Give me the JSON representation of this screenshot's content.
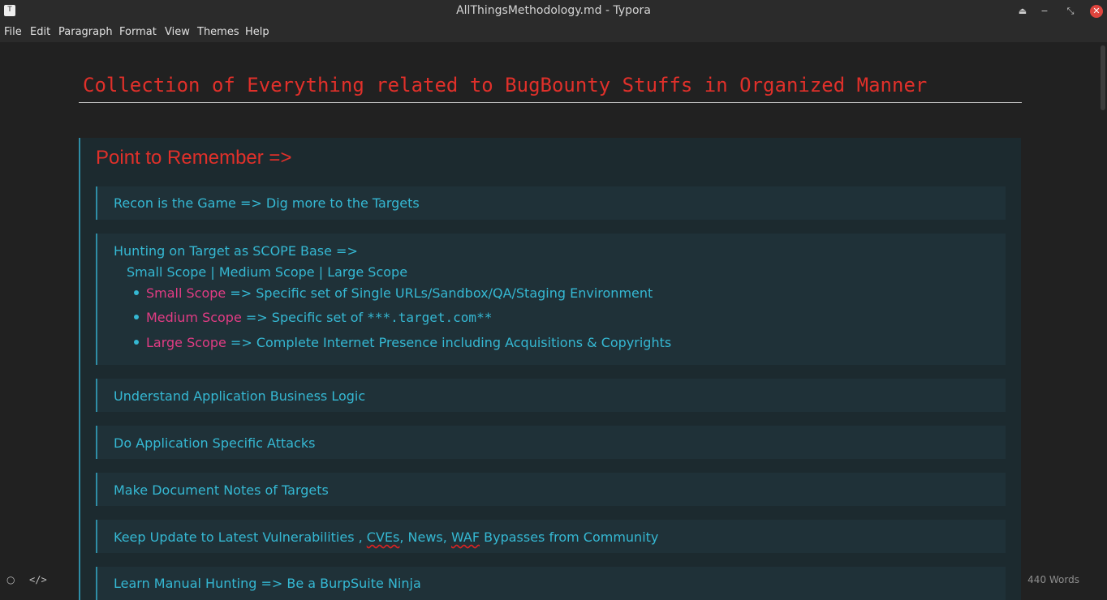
{
  "window": {
    "title": "AllThingsMethodology.md - Typora",
    "app_icon_glyph": "T"
  },
  "menu": [
    "File",
    "Edit",
    "Paragraph",
    "Format",
    "View",
    "Themes",
    "Help"
  ],
  "document": {
    "title": "Collection of Everything related to BugBounty Stuffs in Organized Manner",
    "section_heading": "Point to Remember =>",
    "items": {
      "recon": "Recon is the Game => Dig more to the Targets",
      "scope_intro": "Hunting on Target as SCOPE Base =>",
      "scope_line": "Small Scope | Medium Scope | Large Scope",
      "small_label": "Small Scope",
      "small_desc": " => Specific set of Single URLs/Sandbox/QA/Staging Environment",
      "medium_label": "Medium Scope",
      "medium_desc": " => Specific set of ",
      "medium_code": "***.target.com**",
      "large_label": "Large Scope",
      "large_desc": " => Complete Internet Presence including Acquisitions & Copyrights",
      "business_logic": "Understand Application Business Logic",
      "attacks": "Do Application Specific Attacks",
      "notes": "Make Document Notes of Targets",
      "update_a": "Keep Update to Latest Vulnerabilities , ",
      "update_cves": "CVEs",
      "update_b": ", News, ",
      "update_waf": "WAF",
      "update_c": " Bypasses from Community",
      "manual": "Learn Manual Hunting => Be a BurpSuite Ninja"
    }
  },
  "status": {
    "source_toggle": "</>",
    "word_count": "440 Words"
  },
  "colors": {
    "heading": "#e0302a",
    "text": "#35b8d3",
    "highlight": "#e23c84",
    "background": "#212121",
    "quote_border": "#2f8da6"
  }
}
